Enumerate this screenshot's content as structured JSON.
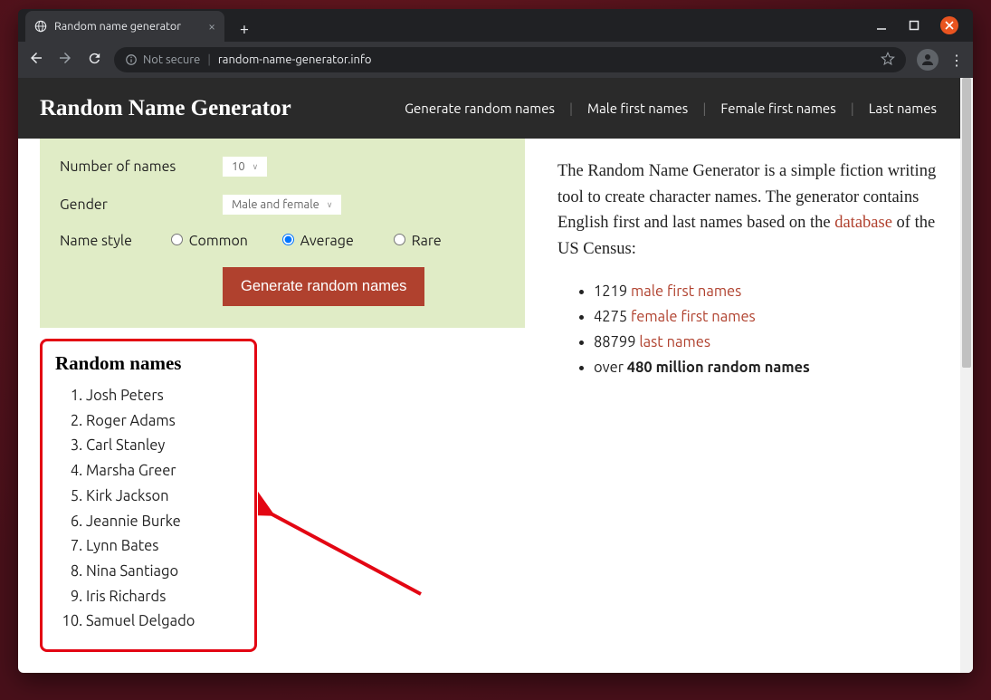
{
  "browser": {
    "tab_title": "Random name generator",
    "not_secure": "Not secure",
    "url": "random-name-generator.info"
  },
  "site": {
    "title": "Random Name Generator",
    "nav": {
      "generate": "Generate random names",
      "male": "Male first names",
      "female": "Female first names",
      "last": "Last names"
    }
  },
  "form": {
    "num_label": "Number of names",
    "num_value": "10",
    "gender_label": "Gender",
    "gender_value": "Male and female",
    "style_label": "Name style",
    "style_common": "Common",
    "style_average": "Average",
    "style_rare": "Rare",
    "button": "Generate random names"
  },
  "results": {
    "heading": "Random names",
    "names": [
      "Josh Peters",
      "Roger Adams",
      "Carl Stanley",
      "Marsha Greer",
      "Kirk Jackson",
      "Jeannie Burke",
      "Lynn Bates",
      "Nina Santiago",
      "Iris Richards",
      "Samuel Delgado"
    ]
  },
  "sidebar": {
    "intro_1": "The Random Name Generator is a simple fiction writing tool to create character names. The generator contains English first and last names based on the ",
    "intro_link": "database",
    "intro_2": " of the US Census:",
    "stats": {
      "male_count": "1219",
      "male_link": "male first names",
      "female_count": "4275",
      "female_link": "female first names",
      "last_count": "88799",
      "last_link": "last names",
      "over_prefix": "over ",
      "over_bold": "480 million random names"
    }
  }
}
